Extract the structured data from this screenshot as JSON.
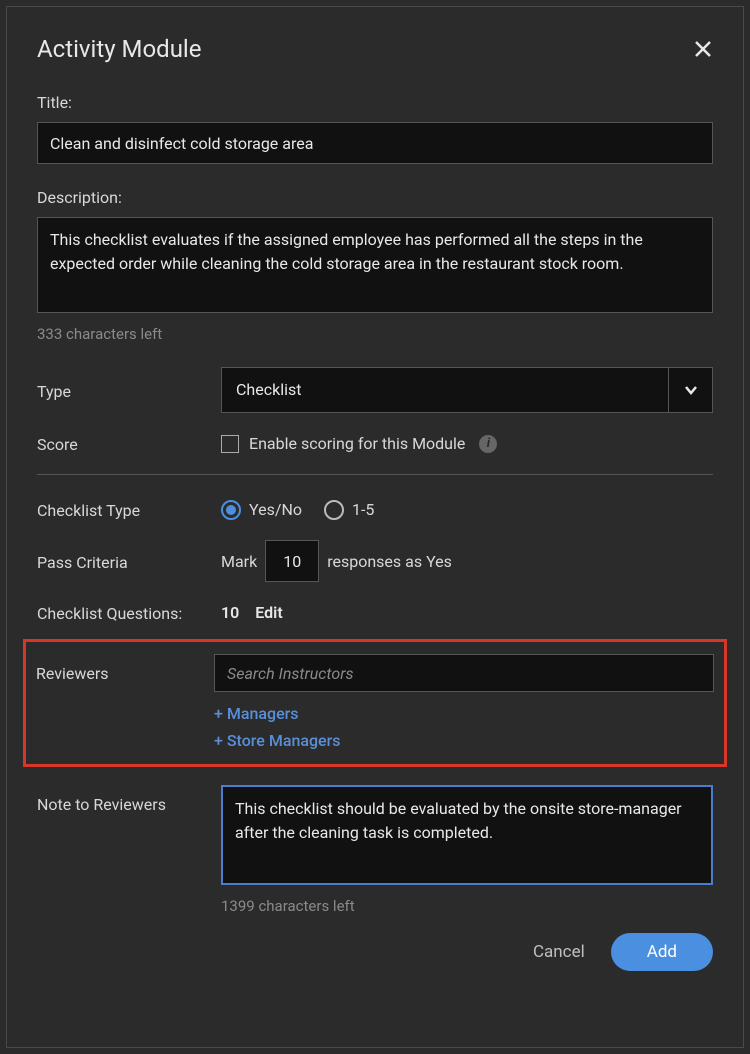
{
  "modal": {
    "title": "Activity Module"
  },
  "title_field": {
    "label": "Title:",
    "value": "Clean and disinfect cold storage area"
  },
  "description_field": {
    "label": "Description:",
    "value": "This checklist evaluates if the assigned employee has performed all the steps in the expected order while cleaning the cold storage area in the restaurant stock room.",
    "chars_left": "333 characters left"
  },
  "type_field": {
    "label": "Type",
    "value": "Checklist"
  },
  "score_field": {
    "label": "Score",
    "checkbox_label": "Enable scoring for this Module"
  },
  "checklist_type": {
    "label": "Checklist Type",
    "options": [
      "Yes/No",
      "1-5"
    ],
    "selected": "Yes/No"
  },
  "pass_criteria": {
    "label": "Pass Criteria",
    "prefix": "Mark",
    "value": "10",
    "suffix": "responses as Yes"
  },
  "checklist_questions": {
    "label": "Checklist Questions:",
    "count": "10",
    "edit_label": "Edit"
  },
  "reviewers": {
    "label": "Reviewers",
    "search_placeholder": "Search Instructors",
    "links": [
      "+ Managers",
      "+ Store Managers"
    ]
  },
  "note_field": {
    "label": "Note to Reviewers",
    "value": "This checklist should be evaluated by the onsite store-manager after the cleaning task is completed.",
    "chars_left": "1399 characters left"
  },
  "footer": {
    "cancel": "Cancel",
    "add": "Add"
  }
}
